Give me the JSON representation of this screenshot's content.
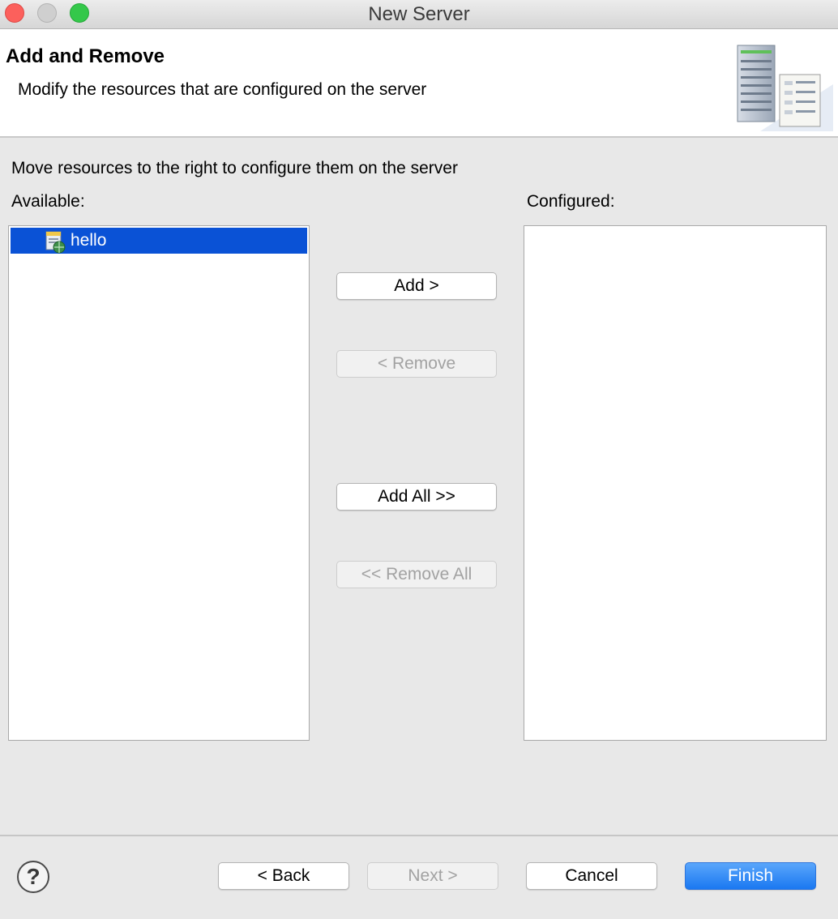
{
  "window": {
    "title": "New Server"
  },
  "header": {
    "title": "Add and Remove",
    "description": "Modify the resources that are configured on the server"
  },
  "main": {
    "instruction": "Move resources to the right to configure them on the server",
    "available_label": "Available:",
    "configured_label": "Configured:",
    "available_items": [
      {
        "label": "hello",
        "icon": "web-project-icon",
        "selected": true
      }
    ],
    "configured_items": []
  },
  "actions": {
    "add": "Add >",
    "remove": "< Remove",
    "add_all": "Add All >>",
    "remove_all": "<< Remove All"
  },
  "footer": {
    "help": "?",
    "back": "< Back",
    "next": "Next >",
    "cancel": "Cancel",
    "finish": "Finish"
  },
  "colors": {
    "selection": "#0a52d6",
    "primary_button": "#1a78f1",
    "close": "#fc605c",
    "maximize": "#34c84a"
  }
}
